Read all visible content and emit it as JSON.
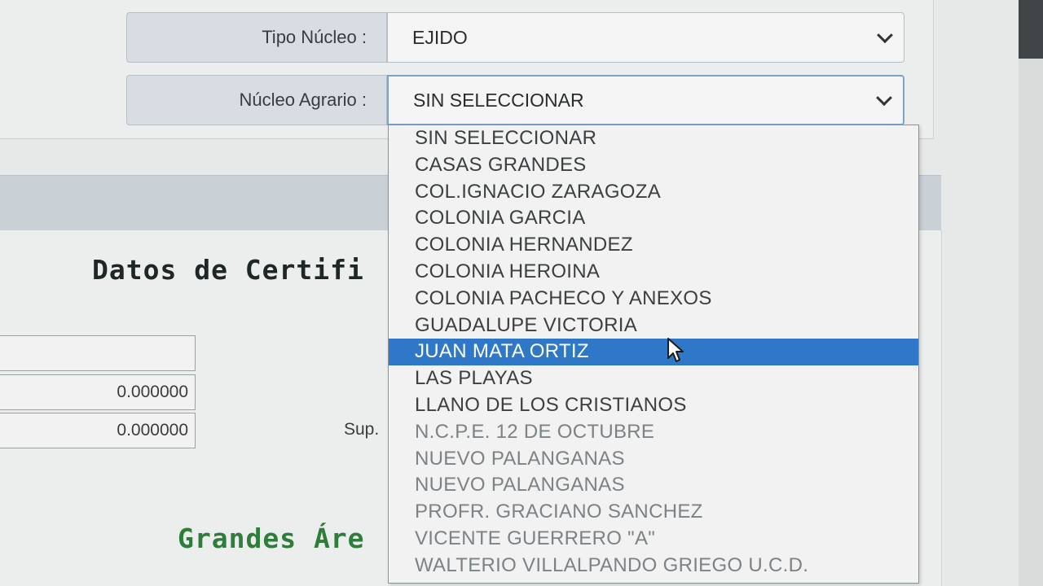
{
  "form": {
    "tipo_nucleo": {
      "label": "Tipo Núcleo :",
      "value": "EJIDO"
    },
    "nucleo_agrario": {
      "label": "Núcleo Agrario :",
      "value": "SIN SELECCIONAR"
    }
  },
  "dropdown": {
    "options": [
      "SIN SELECCIONAR",
      "CASAS GRANDES",
      "COL.IGNACIO ZARAGOZA",
      "COLONIA GARCIA",
      "COLONIA HERNANDEZ",
      "COLONIA HEROINA",
      "COLONIA PACHECO Y ANEXOS",
      "GUADALUPE VICTORIA",
      "JUAN MATA ORTIZ",
      "LAS PLAYAS",
      "LLANO DE LOS CRISTIANOS",
      "N.C.P.E. 12 DE OCTUBRE",
      "NUEVO PALANGANAS",
      "NUEVO PALANGANAS",
      "PROFR. GRACIANO SANCHEZ",
      "VICENTE GUERRERO \"A\"",
      "WALTERIO VILLALPANDO GRIEGO U.C.D."
    ],
    "highlighted": "JUAN MATA ORTIZ"
  },
  "section": {
    "heading": "Datos de Certifi",
    "heading2": "Grandes Áre",
    "inputs": [
      "",
      "0.000000",
      "0.000000"
    ],
    "sup_label": "Sup."
  },
  "colors": {
    "highlight": "#2f78c7",
    "heading2": "#2e7d3a"
  }
}
